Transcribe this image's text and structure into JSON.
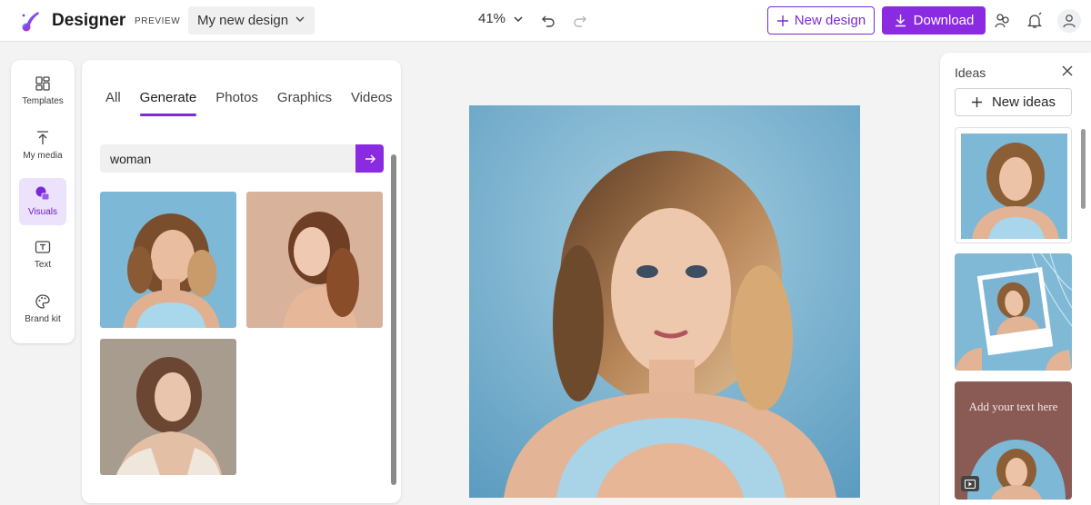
{
  "app": {
    "name": "Designer",
    "badge": "PREVIEW"
  },
  "header": {
    "design_name": "My new design",
    "zoom": "41%",
    "new_design_label": "New design",
    "download_label": "Download"
  },
  "rail": {
    "items": [
      {
        "label": "Templates",
        "icon": "templates-icon"
      },
      {
        "label": "My media",
        "icon": "upload-icon"
      },
      {
        "label": "Visuals",
        "icon": "visuals-icon",
        "active": true
      },
      {
        "label": "Text",
        "icon": "text-icon"
      },
      {
        "label": "Brand kit",
        "icon": "palette-icon"
      }
    ]
  },
  "visuals": {
    "tabs": [
      "All",
      "Generate",
      "Photos",
      "Graphics",
      "Videos"
    ],
    "active_tab": "Generate",
    "search_value": "woman"
  },
  "ideas": {
    "title": "Ideas",
    "new_ideas_label": "New ideas",
    "card3_text": "Add your text here"
  },
  "colors": {
    "accent": "#8a2be2",
    "canvas_bg": "#7fb6d3",
    "idea3_bg": "#8a5a55"
  }
}
